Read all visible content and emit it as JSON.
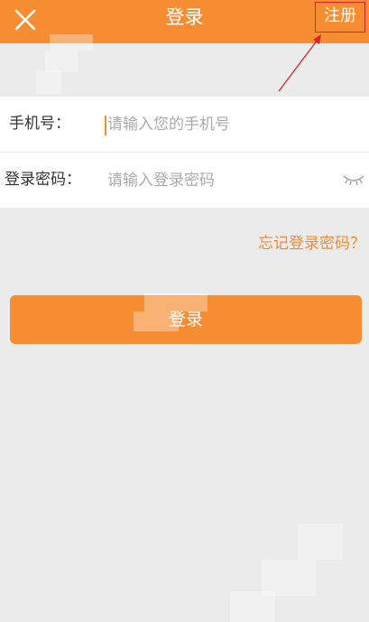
{
  "header": {
    "close_icon": "close-icon",
    "title": "登录",
    "register_label": "注册",
    "background_color": "#f68d33"
  },
  "form": {
    "phone": {
      "label": "手机号：",
      "placeholder": "请输入您的手机号",
      "value": ""
    },
    "password": {
      "label": "登录密码：",
      "placeholder": "请输入登录密码",
      "value": "",
      "toggle_icon": "eye-closed-icon"
    }
  },
  "forgot_password_label": "忘记登录密码？",
  "login_button_label": "登录",
  "colors": {
    "accent": "#f68d33",
    "annotation": "#d8232a",
    "page_background": "#ebebeb"
  }
}
